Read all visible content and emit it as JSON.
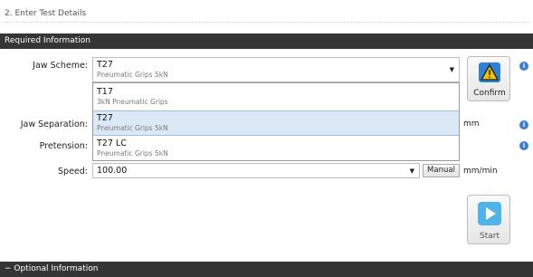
{
  "section": {
    "title": "2. Enter Test Details"
  },
  "required": {
    "header": "Required Information"
  },
  "optional": {
    "header": "Optional Information",
    "toggle_symbol": "−"
  },
  "jaw_scheme": {
    "label": "Jaw Scheme:",
    "value_title": "T27",
    "value_sub": "Pneumatic Grips 5kN",
    "options": [
      {
        "title": "T17",
        "sub": "3kN Pneumatic Grips",
        "selected": false
      },
      {
        "title": "T27",
        "sub": "Pneumatic Grips 5kN",
        "selected": true
      },
      {
        "title": "T27 LC",
        "sub": "Pneumatic Grips 5kN",
        "selected": false
      }
    ]
  },
  "confirm_button": {
    "label": "Confirm",
    "icon": "warning-icon",
    "icon_color": "#f2c300"
  },
  "jaw_separation": {
    "label": "Jaw Separation:",
    "unit": "mm"
  },
  "pretension": {
    "label": "Pretension:"
  },
  "speed": {
    "label": "Speed:",
    "value": "100.00",
    "manual_label": "Manual",
    "unit": "mm/min"
  },
  "start_button": {
    "label": "Start",
    "icon": "play-icon",
    "icon_color": "#4fb4e8"
  },
  "info_icon": {
    "glyph": "i",
    "color": "#3c7fd1"
  },
  "colors": {
    "header_bar": "#353535",
    "selected_option": "#dbe9f7"
  }
}
